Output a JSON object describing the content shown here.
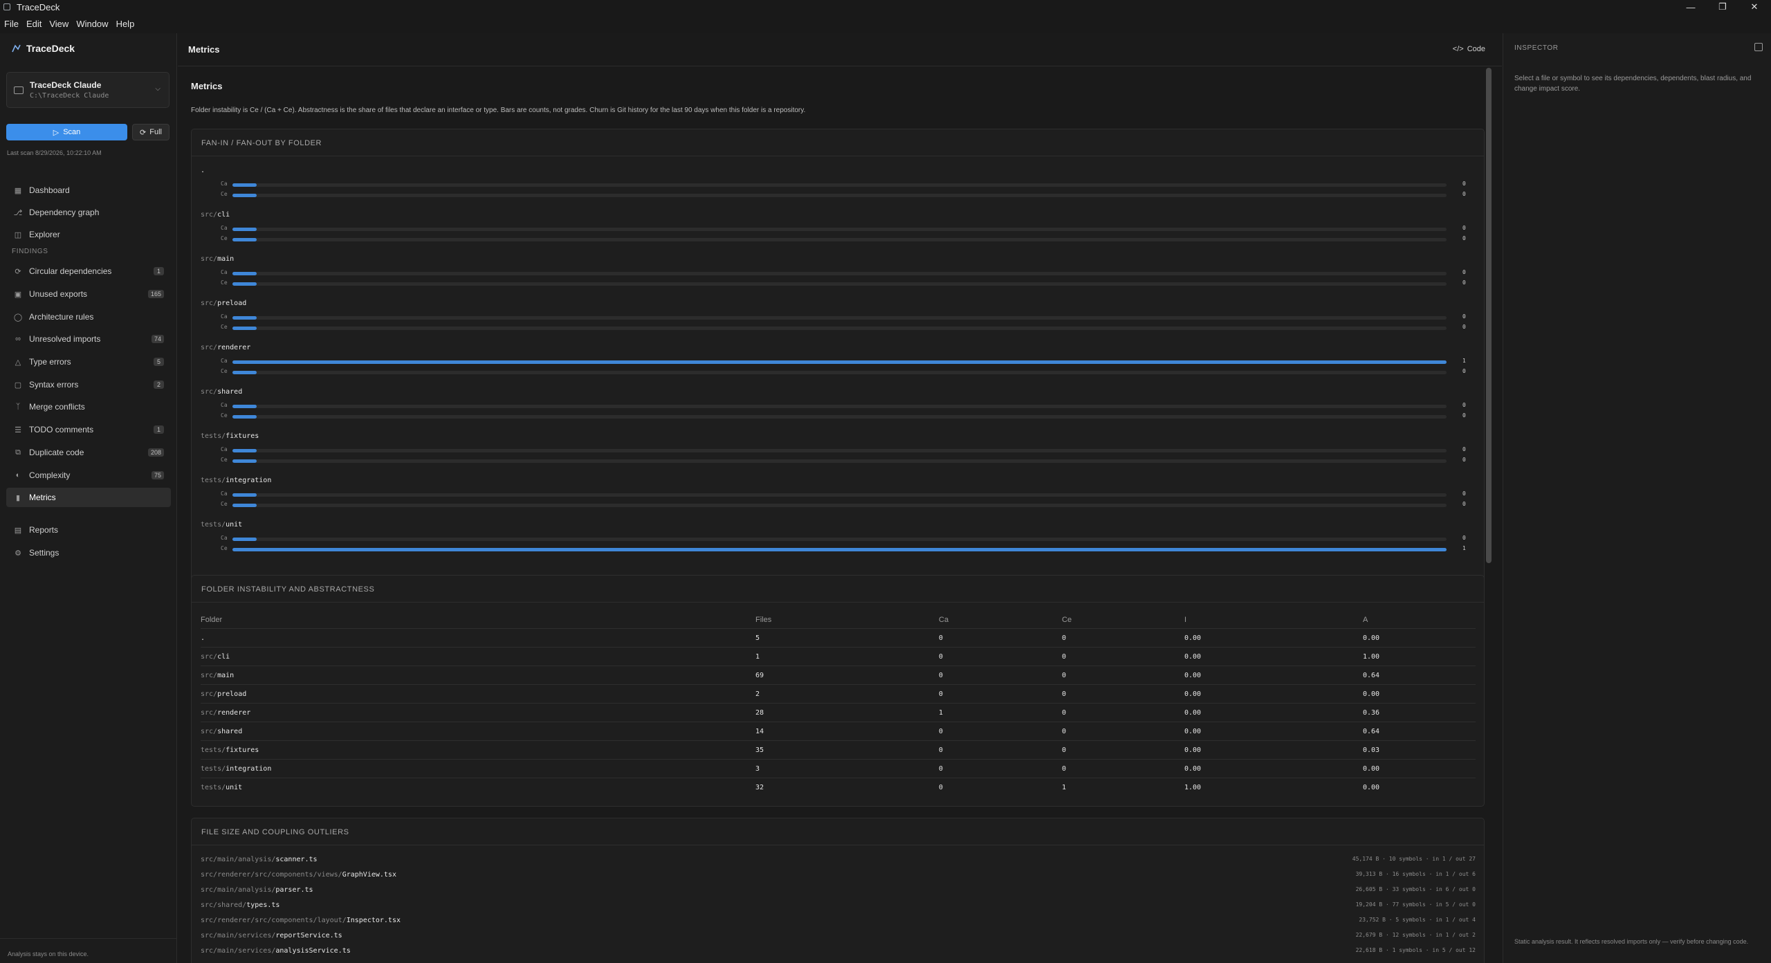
{
  "window": {
    "title": "TraceDeck",
    "menu": [
      "File",
      "Edit",
      "View",
      "Window",
      "Help"
    ]
  },
  "sidebar": {
    "brand": "TraceDeck",
    "workspace": {
      "name": "TraceDeck Claude",
      "path": "C:\\TraceDeck Claude"
    },
    "scan_label": "Scan",
    "full_label": "Full",
    "last_scan": "Last scan 8/29/2026, 10:22:10 AM",
    "nav": [
      {
        "label": "Dashboard",
        "icon": "grid-icon"
      },
      {
        "label": "Dependency graph",
        "icon": "graph-icon"
      },
      {
        "label": "Explorer",
        "icon": "files-icon"
      }
    ],
    "findings_heading": "FINDINGS",
    "findings": [
      {
        "label": "Circular dependencies",
        "badge": "1",
        "icon": "cycle-icon"
      },
      {
        "label": "Unused exports",
        "badge": "165",
        "icon": "package-icon"
      },
      {
        "label": "Architecture rules",
        "badge": "",
        "icon": "shield-icon"
      },
      {
        "label": "Unresolved imports",
        "badge": "74",
        "icon": "unlink-icon"
      },
      {
        "label": "Type errors",
        "badge": "5",
        "icon": "warning-icon"
      },
      {
        "label": "Syntax errors",
        "badge": "2",
        "icon": "file-error-icon"
      },
      {
        "label": "Merge conflicts",
        "badge": "",
        "icon": "merge-icon"
      },
      {
        "label": "TODO comments",
        "badge": "1",
        "icon": "list-icon"
      },
      {
        "label": "Duplicate code",
        "badge": "208",
        "icon": "copy-icon"
      },
      {
        "label": "Complexity",
        "badge": "75",
        "icon": "gauge-icon"
      },
      {
        "label": "Metrics",
        "badge": "",
        "icon": "bar-chart-icon"
      }
    ],
    "bottom": [
      {
        "label": "Reports",
        "icon": "report-icon"
      },
      {
        "label": "Settings",
        "icon": "gear-icon"
      }
    ],
    "footer": "Analysis stays on this device."
  },
  "main": {
    "header_title": "Metrics",
    "code_label": "Code",
    "page_title": "Metrics",
    "description": "Folder instability is Ce / (Ca + Ce). Abstractness is the share of files that declare an interface or type. Bars are counts, not grades. Churn is Git history for the last 90 days when this folder is a repository.",
    "fan": {
      "title": "FAN-IN / FAN-OUT BY FOLDER",
      "ca_label": "Ca",
      "ce_label": "Ce",
      "folders": [
        {
          "prefix": "",
          "name": ".",
          "ca": "0",
          "ce": "0",
          "ca_frac": 0.02,
          "ce_frac": 0.02
        },
        {
          "prefix": "src/",
          "name": "cli",
          "ca": "0",
          "ce": "0",
          "ca_frac": 0.02,
          "ce_frac": 0.02
        },
        {
          "prefix": "src/",
          "name": "main",
          "ca": "0",
          "ce": "0",
          "ca_frac": 0.02,
          "ce_frac": 0.02
        },
        {
          "prefix": "src/",
          "name": "preload",
          "ca": "0",
          "ce": "0",
          "ca_frac": 0.02,
          "ce_frac": 0.02
        },
        {
          "prefix": "src/",
          "name": "renderer",
          "ca": "1",
          "ce": "0",
          "ca_frac": 1,
          "ce_frac": 0.02
        },
        {
          "prefix": "src/",
          "name": "shared",
          "ca": "0",
          "ce": "0",
          "ca_frac": 0.02,
          "ce_frac": 0.02
        },
        {
          "prefix": "tests/",
          "name": "fixtures",
          "ca": "0",
          "ce": "0",
          "ca_frac": 0.02,
          "ce_frac": 0.02
        },
        {
          "prefix": "tests/",
          "name": "integration",
          "ca": "0",
          "ce": "0",
          "ca_frac": 0.02,
          "ce_frac": 0.02
        },
        {
          "prefix": "tests/",
          "name": "unit",
          "ca": "0",
          "ce": "1",
          "ca_frac": 0.02,
          "ce_frac": 1
        }
      ]
    },
    "instability": {
      "title": "FOLDER INSTABILITY AND ABSTRACTNESS",
      "columns": [
        "Folder",
        "Files",
        "Ca",
        "Ce",
        "I",
        "A"
      ],
      "rows": [
        {
          "prefix": "",
          "name": ".",
          "files": "5",
          "ca": "0",
          "ce": "0",
          "i": "0.00",
          "a": "0.00"
        },
        {
          "prefix": "src/",
          "name": "cli",
          "files": "1",
          "ca": "0",
          "ce": "0",
          "i": "0.00",
          "a": "1.00"
        },
        {
          "prefix": "src/",
          "name": "main",
          "files": "69",
          "ca": "0",
          "ce": "0",
          "i": "0.00",
          "a": "0.64"
        },
        {
          "prefix": "src/",
          "name": "preload",
          "files": "2",
          "ca": "0",
          "ce": "0",
          "i": "0.00",
          "a": "0.00"
        },
        {
          "prefix": "src/",
          "name": "renderer",
          "files": "28",
          "ca": "1",
          "ce": "0",
          "i": "0.00",
          "a": "0.36"
        },
        {
          "prefix": "src/",
          "name": "shared",
          "files": "14",
          "ca": "0",
          "ce": "0",
          "i": "0.00",
          "a": "0.64"
        },
        {
          "prefix": "tests/",
          "name": "fixtures",
          "files": "35",
          "ca": "0",
          "ce": "0",
          "i": "0.00",
          "a": "0.03"
        },
        {
          "prefix": "tests/",
          "name": "integration",
          "files": "3",
          "ca": "0",
          "ce": "0",
          "i": "0.00",
          "a": "0.00"
        },
        {
          "prefix": "tests/",
          "name": "unit",
          "files": "32",
          "ca": "0",
          "ce": "1",
          "i": "1.00",
          "a": "0.00"
        }
      ]
    },
    "outliers": {
      "title": "FILE SIZE AND COUPLING OUTLIERS",
      "rows": [
        {
          "prefix": "src/main/analysis/",
          "name": "scanner.ts",
          "meta": "45,174 B · 10 symbols · in 1 / out 27"
        },
        {
          "prefix": "src/renderer/src/components/views/",
          "name": "GraphView.tsx",
          "meta": "39,313 B · 16 symbols · in 1 / out 6"
        },
        {
          "prefix": "src/main/analysis/",
          "name": "parser.ts",
          "meta": "26,605 B · 33 symbols · in 6 / out 0"
        },
        {
          "prefix": "src/shared/",
          "name": "types.ts",
          "meta": "19,204 B · 77 symbols · in 5 / out 0"
        },
        {
          "prefix": "src/renderer/src/components/layout/",
          "name": "Inspector.tsx",
          "meta": "23,752 B · 5 symbols · in 1 / out 4"
        },
        {
          "prefix": "src/main/services/",
          "name": "reportService.ts",
          "meta": "22,679 B · 12 symbols · in 1 / out 2"
        },
        {
          "prefix": "src/main/services/",
          "name": "analysisService.ts",
          "meta": "22,618 B · 1 symbols · in 5 / out 12"
        }
      ]
    }
  },
  "inspector": {
    "title": "INSPECTOR",
    "description": "Select a file or symbol to see its dependencies, dependents, blast radius, and change impact score.",
    "footer": "Static analysis result. It reflects resolved imports only — verify before changing code."
  },
  "colors": {
    "accent": "#3b8eea",
    "bar": "#3f87d8",
    "background": "#191919"
  }
}
